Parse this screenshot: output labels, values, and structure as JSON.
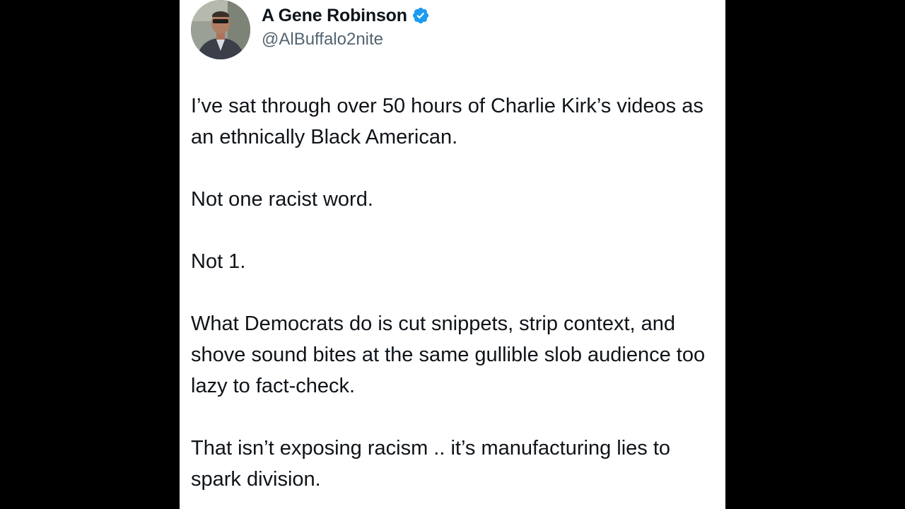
{
  "tweet": {
    "author": {
      "display_name": "A Gene Robinson",
      "handle": "@AlBuffalo2nite",
      "verified": true,
      "verified_color": "#1d9bf0"
    },
    "paragraphs": [
      "I’ve sat through over 50 hours of Charlie Kirk’s videos as an ethnically Black American.",
      "Not one racist word.",
      "Not 1.",
      "What Democrats do is cut snippets, strip context, and shove sound bites at the same gullible slob audience too lazy to fact-check.",
      "That isn’t exposing racism .. it’s manufacturing lies to spark division."
    ]
  },
  "colors": {
    "background": "#000000",
    "card": "#ffffff",
    "text": "#0f1419",
    "handle": "#536471"
  },
  "icons": {
    "avatar": "profile-photo",
    "verified": "verified-badge-icon"
  }
}
